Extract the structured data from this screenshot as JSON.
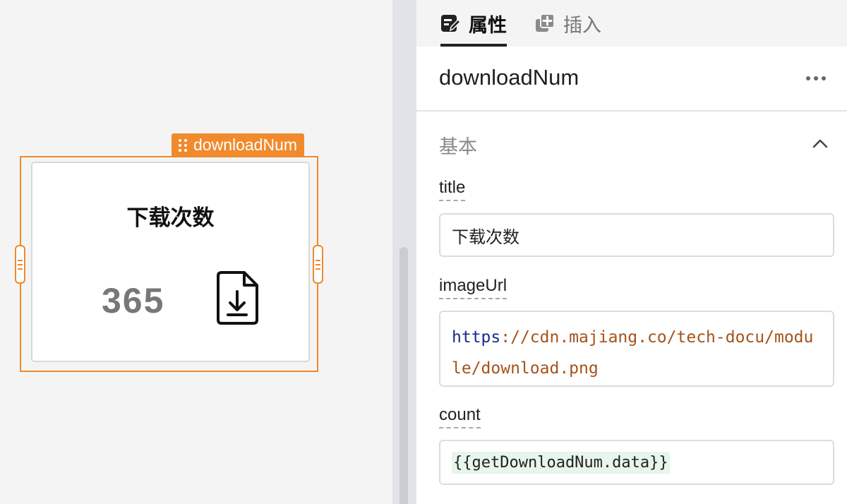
{
  "canvas": {
    "selected_component": "downloadNum",
    "card": {
      "title": "下载次数",
      "count": "365",
      "icon": "file-download-icon"
    }
  },
  "panel": {
    "tabs": [
      {
        "label": "属性",
        "icon": "properties-edit-icon",
        "active": true
      },
      {
        "label": "插入",
        "icon": "insert-add-icon",
        "active": false
      }
    ],
    "component_name": "downloadNum",
    "section": {
      "title": "基本",
      "expanded": true
    },
    "fields": {
      "title": {
        "label": "title",
        "value": "下载次数"
      },
      "imageUrl": {
        "label": "imageUrl",
        "value_scheme": "https",
        "value_rest": "://cdn.majiang.co/tech-docu/module/download.png"
      },
      "count": {
        "label": "count",
        "value": "{{getDownloadNum.data}}"
      }
    }
  },
  "colors": {
    "selection": "#f08a2c",
    "url_scheme": "#1a2a8a",
    "url_string": "#a5521a",
    "code_bg": "#e7f5ea"
  }
}
